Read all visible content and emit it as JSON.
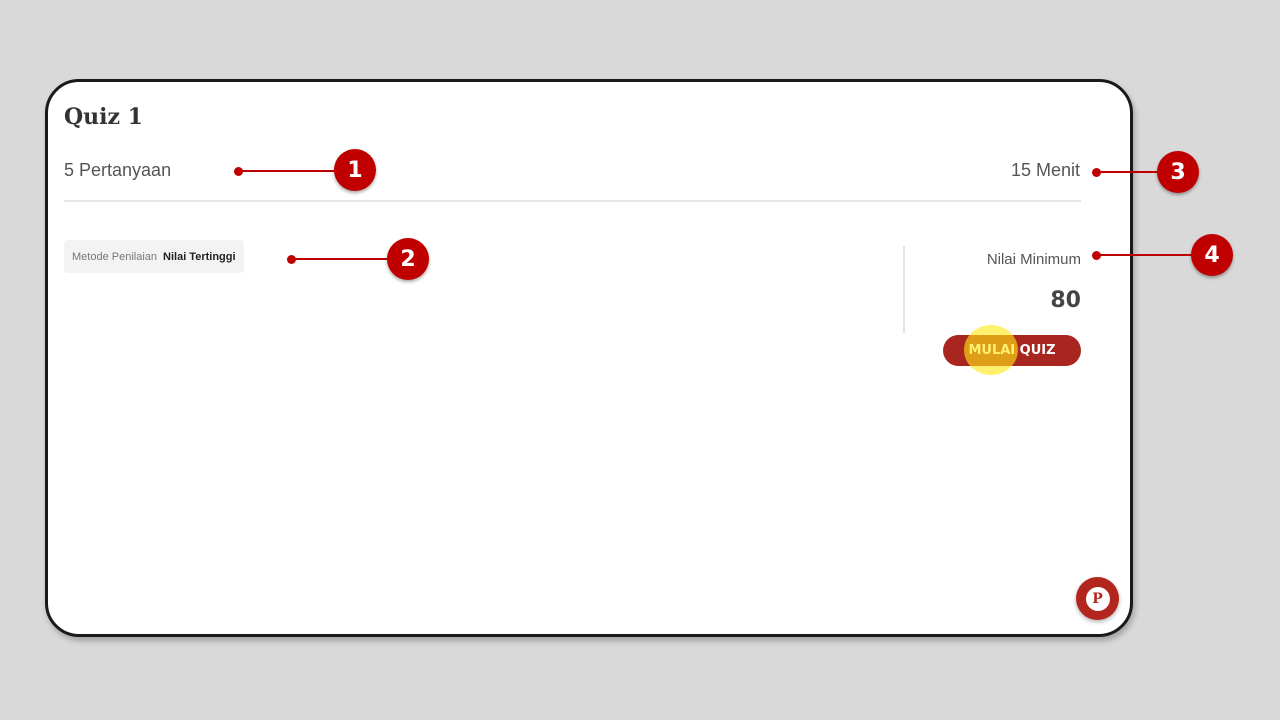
{
  "quiz": {
    "title": "Quiz 1",
    "question_count": "5 Pertanyaan",
    "duration": "15 Menit",
    "method_label": "Metode Penilaian",
    "method_value": "Nilai Tertinggi",
    "min_score_label": "Nilai Minimum",
    "min_score_value": "80",
    "start_button": "MULAI QUIZ"
  },
  "chat": {
    "icon": "chat-bubble-p-icon",
    "letter": "P"
  },
  "callouts": [
    "1",
    "2",
    "3",
    "4"
  ],
  "colors": {
    "accent": "#a8261f",
    "callout": "#c00000",
    "highlight": "#ffe814"
  }
}
